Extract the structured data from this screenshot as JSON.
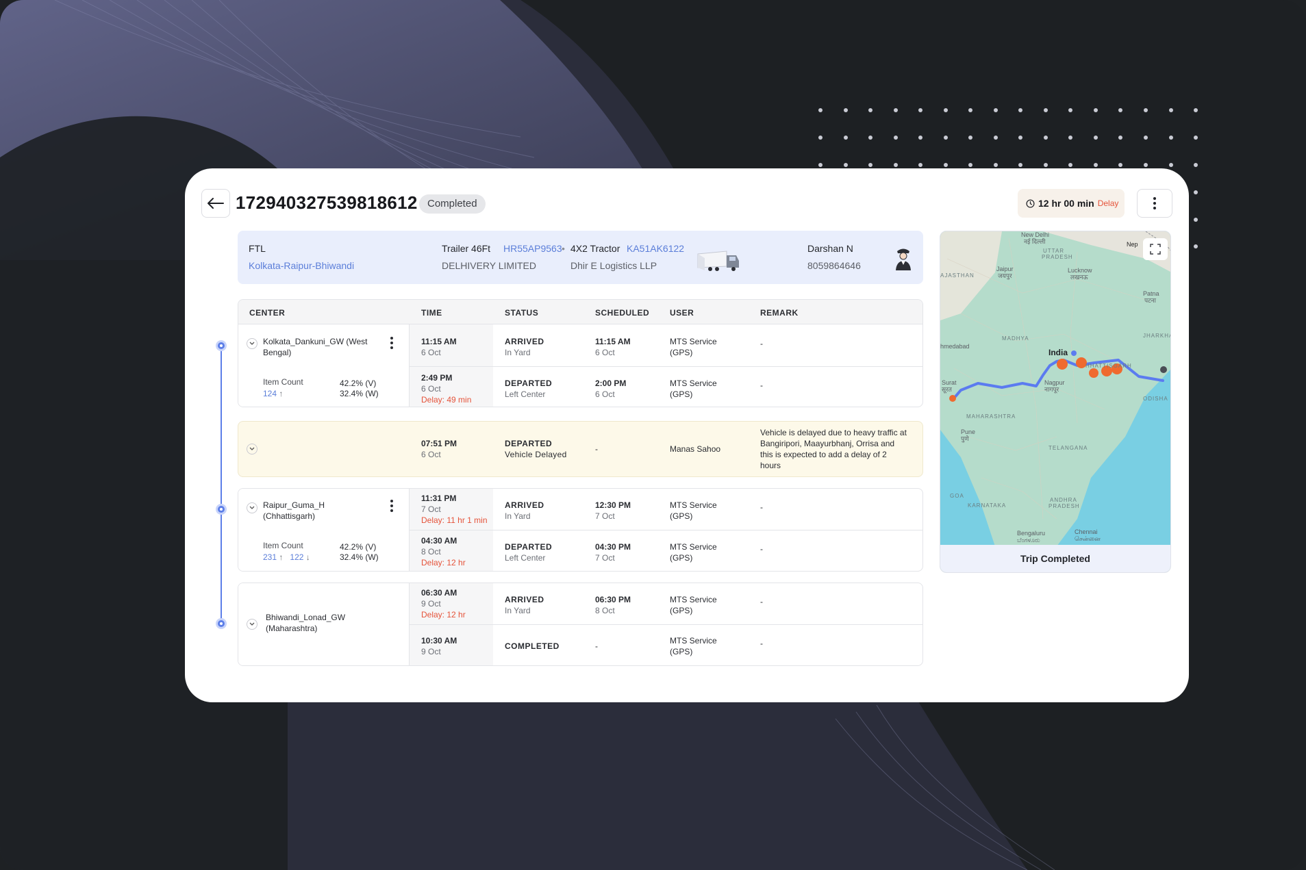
{
  "header": {
    "trip_id": "172940327539818612",
    "status": "Completed",
    "delay_time": "12 hr 00 min",
    "delay_label": "Delay"
  },
  "info": {
    "mode": "FTL",
    "route": "Kolkata-Raipur-Bhiwandi",
    "trailer_label": "Trailer 46Ft",
    "trailer_no": "HR55AP9563",
    "separator": "•",
    "tractor_label": "4X2 Tractor",
    "tractor_no": "KA51AK6122",
    "company1": "DELHIVERY LIMITED",
    "company2": "Dhir E Logistics LLP",
    "driver_name": "Darshan N",
    "driver_phone": "8059864646"
  },
  "table": {
    "columns": [
      "CENTER",
      "TIME",
      "STATUS",
      "SCHEDULED",
      "USER",
      "REMARK"
    ],
    "groups": [
      {
        "center": "Kolkata_Dankuni_GW (West Bengal)",
        "center_l1": "Kolkata_Dankuni_GW (West",
        "center_l2": "Bengal)",
        "item_count_label": "Item Count",
        "item_count_up": "124",
        "item_count_down": "",
        "pct_v": "42.2% (V)",
        "pct_w": "32.4% (W)",
        "rows": [
          {
            "time": "11:15 AM",
            "date": "6 Oct",
            "delay": "",
            "status": "ARRIVED",
            "sub": "In Yard",
            "sched_time": "11:15 AM",
            "sched_date": "6 Oct",
            "user1": "MTS Service",
            "user2": "(GPS)",
            "remark": "-"
          },
          {
            "time": "2:49 PM",
            "date": "6 Oct",
            "delay": "Delay: 49 min",
            "status": "DEPARTED",
            "sub": "Left Center",
            "sched_time": "2:00 PM",
            "sched_date": "6 Oct",
            "user1": "MTS Service",
            "user2": "(GPS)",
            "remark": "-"
          }
        ]
      },
      {
        "rows": [
          {
            "time": "07:51 PM",
            "date": "6 Oct",
            "status": "DEPARTED",
            "sub": "Vehicle Delayed",
            "sched": "-",
            "user": "Manas Sahoo",
            "remark_l1": "Vehicle is delayed due to heavy traffic at",
            "remark_l2": "Bangiripori, Maayurbhanj, Orrisa and",
            "remark_l3": "this is expected to add a delay of 2",
            "remark_l4": "hours"
          }
        ]
      },
      {
        "center_l1": "Raipur_Guma_H",
        "center_l2": "(Chhattisgarh)",
        "item_count_label": "Item Count",
        "item_count_up": "231",
        "item_count_down": "122",
        "pct_v": "42.2% (V)",
        "pct_w": "32.4% (W)",
        "rows": [
          {
            "time": "11:31 PM",
            "date": "7 Oct",
            "delay": "Delay: 11 hr 1 min",
            "status": "ARRIVED",
            "sub": "In Yard",
            "sched_time": "12:30 PM",
            "sched_date": "7 Oct",
            "user1": "MTS Service",
            "user2": "(GPS)",
            "remark": "-"
          },
          {
            "time": "04:30 AM",
            "date": "8 Oct",
            "delay": "Delay: 12 hr",
            "status": "DEPARTED",
            "sub": "Left Center",
            "sched_time": "04:30 PM",
            "sched_date": "7 Oct",
            "user1": "MTS Service",
            "user2": "(GPS)",
            "remark": "-"
          }
        ]
      },
      {
        "center_l1": "Bhiwandi_Lonad_GW",
        "center_l2": "(Maharashtra)",
        "rows": [
          {
            "time": "06:30 AM",
            "date": "9 Oct",
            "delay": "Delay: 12 hr",
            "status": "ARRIVED",
            "sub": "In Yard",
            "sched_time": "06:30 PM",
            "sched_date": "8 Oct",
            "user1": "MTS Service",
            "user2": "(GPS)",
            "remark": "-"
          },
          {
            "time": "10:30 AM",
            "date": "9 Oct",
            "delay": "",
            "status": "COMPLETED",
            "sub": "",
            "sched": "-",
            "user1": "MTS Service",
            "user2": "(GPS)",
            "remark": "-"
          }
        ]
      }
    ]
  },
  "map": {
    "footer": "Trip Completed",
    "labels": {
      "new_delhi": "New Delhi",
      "new_delhi_local": "नई दिल्ली",
      "nepal": "Nep",
      "uttar": "UTTAR",
      "pradesh": "PRADESH",
      "jaipur": "Jaipur",
      "jaipur_local": "जयपुर",
      "lucknow": "Lucknow",
      "lucknow_local": "लखनऊ",
      "rajasthan": "AJASTHAN",
      "patna": "Patna",
      "patna_local": "पटना",
      "madhya": "MADHYA",
      "ahmedabad": "hmedabad",
      "india": "India",
      "jharkhand": "JHARKHAN",
      "chhattisgarh": "HHATTISGARH",
      "surat": "Surat",
      "surat_local": "सूरत",
      "nagpur": "Nagpur",
      "nagpur_local": "नागपूर",
      "maharashtra": "MAHARASHTRA",
      "odisha": "ODISHA",
      "pune": "Pune",
      "pune_local": "पुणे",
      "telangana": "TELANGANA",
      "goa": "GOA",
      "karnataka": "KARNATAKA",
      "andhra": "ANDHRA",
      "andhra_pradesh": "PRADESH",
      "bengaluru": "Bengaluru",
      "bengaluru_local": "ಬೆಂಗಳೂರು",
      "chennai": "Chennai",
      "chennai_local": "சென்னை"
    }
  },
  "colors": {
    "accent": "#5c7ee8",
    "delay": "#e5533a",
    "route": "#5b7bf0",
    "marker": "#ef6a2f"
  }
}
